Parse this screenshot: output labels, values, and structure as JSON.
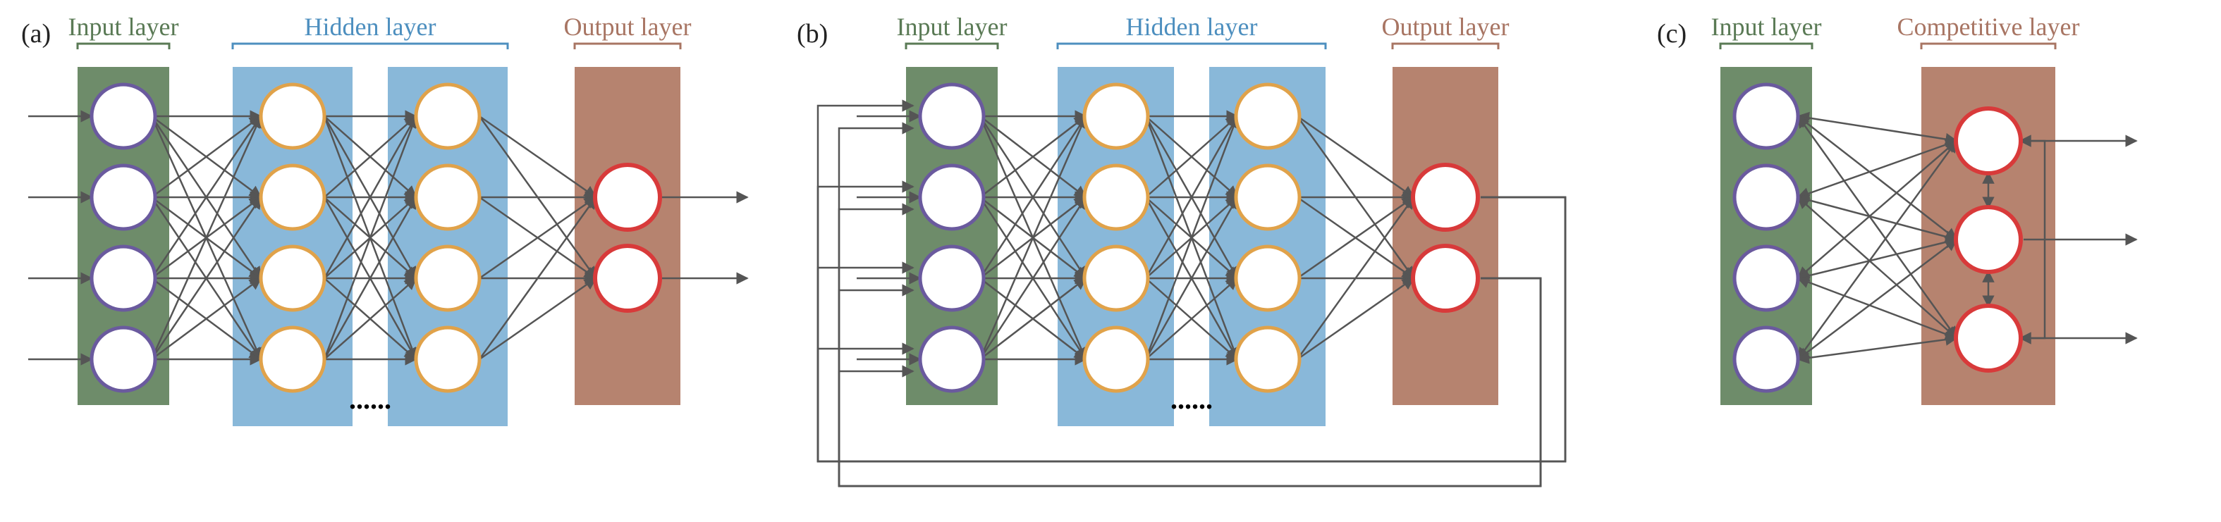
{
  "colors": {
    "input_fill": "#6e8c6a",
    "hidden_fill": "#89b8d9",
    "output_fill": "#b6836f",
    "input_text": "#5a7a55",
    "hidden_text": "#4d8fbf",
    "output_text": "#a87563",
    "node_purple": "#6a5a9e",
    "node_orange": "#e0a24a",
    "node_red": "#d83a3a",
    "edge": "#555555"
  },
  "chart_data": [
    {
      "type": "network-diagram",
      "title": "Feedforward MLP",
      "panel": "(a)",
      "layers": [
        {
          "role": "input",
          "label": "Input layer",
          "nodes": 4,
          "outline": "purple"
        },
        {
          "role": "hidden",
          "label": "Hidden layer",
          "nodes": 4,
          "outline": "orange",
          "repeated": true,
          "ellipsis_after": true
        },
        {
          "role": "hidden",
          "nodes": 4,
          "outline": "orange"
        },
        {
          "role": "output",
          "label": "Output layer",
          "nodes": 2,
          "outline": "red"
        }
      ],
      "connections": "fully-connected-forward",
      "external_inputs": 4,
      "external_outputs": 2,
      "feedback": false
    },
    {
      "type": "network-diagram",
      "title": "Recurrent MLP (output fed back to input)",
      "panel": "(b)",
      "layers": [
        {
          "role": "input",
          "label": "Input layer",
          "nodes": 4,
          "outline": "purple"
        },
        {
          "role": "hidden",
          "label": "Hidden layer",
          "nodes": 4,
          "outline": "orange",
          "repeated": true,
          "ellipsis_after": true
        },
        {
          "role": "hidden",
          "nodes": 4,
          "outline": "orange"
        },
        {
          "role": "output",
          "label": "Output layer",
          "nodes": 2,
          "outline": "red"
        }
      ],
      "connections": "fully-connected-forward",
      "external_inputs": 4,
      "external_outputs": 2,
      "feedback": true,
      "feedback_desc": "each output routed back as extra input arrow into every input node"
    },
    {
      "type": "network-diagram",
      "title": "Competitive / Kohonen-style network",
      "panel": "(c)",
      "layers": [
        {
          "role": "input",
          "label": "Input layer",
          "nodes": 4,
          "outline": "purple"
        },
        {
          "role": "output",
          "label": "Competitive layer",
          "nodes": 3,
          "outline": "red",
          "lateral_inhibition": true
        }
      ],
      "connections": "fully-connected-bidirectional",
      "external_outputs": 3,
      "feedback": false
    }
  ],
  "labels": {
    "panel_a": "(a)",
    "panel_b": "(b)",
    "panel_c": "(c)",
    "input": "Input layer",
    "hidden": "Hidden layer",
    "output": "Output layer",
    "competitive": "Competitive layer",
    "dots": "......"
  }
}
